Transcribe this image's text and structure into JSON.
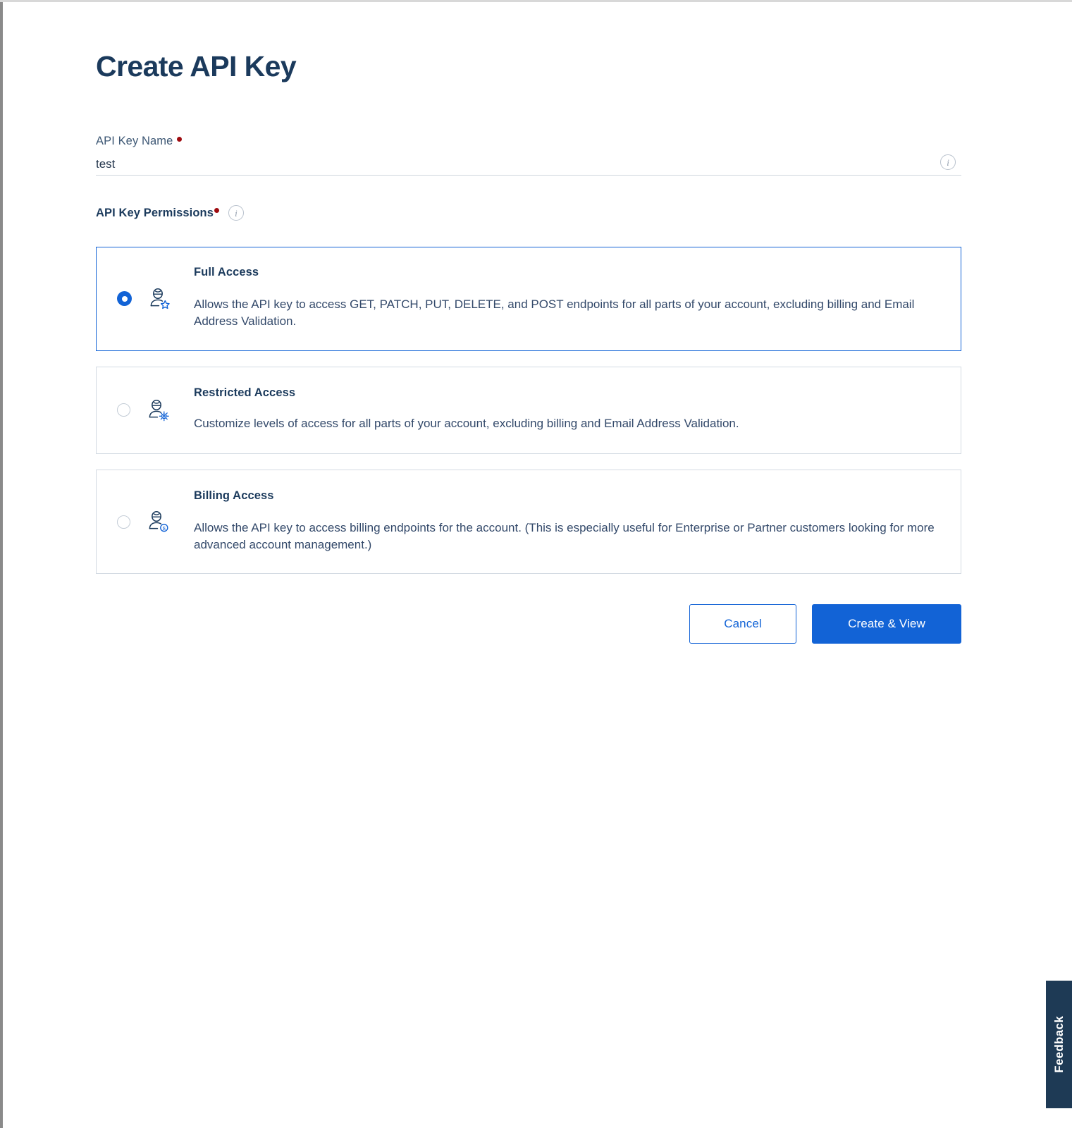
{
  "page": {
    "title": "Create API Key"
  },
  "api_key_name": {
    "label": "API Key Name",
    "value": "test",
    "placeholder": "",
    "required": true,
    "info_icon": "info-icon"
  },
  "permissions": {
    "heading": "API Key Permissions",
    "required": true,
    "info_icon": "info-icon",
    "selected": "full_access",
    "options": [
      {
        "id": "full_access",
        "title": "Full Access",
        "description": "Allows the API key to access GET, PATCH, PUT, DELETE, and POST endpoints for all parts of your account, excluding billing and Email Address Validation.",
        "icon": "user-star-icon",
        "selected": true
      },
      {
        "id": "restricted_access",
        "title": "Restricted Access",
        "description": "Customize levels of access for all parts of your account, excluding billing and Email Address Validation.",
        "icon": "user-gear-icon",
        "selected": false
      },
      {
        "id": "billing_access",
        "title": "Billing Access",
        "description": "Allows the API key to access billing endpoints for the account. (This is especially useful for Enterprise or Partner customers looking for more advanced account management.)",
        "icon": "user-dollar-icon",
        "selected": false
      }
    ]
  },
  "actions": {
    "cancel_label": "Cancel",
    "submit_label": "Create & View"
  },
  "feedback": {
    "label": "Feedback"
  },
  "colors": {
    "accent_blue": "#1263d6",
    "title_navy": "#1b3a5c",
    "required_red": "#9e0b0f",
    "border_gray": "#d3dae2",
    "feedback_bg": "#1e3a55"
  }
}
